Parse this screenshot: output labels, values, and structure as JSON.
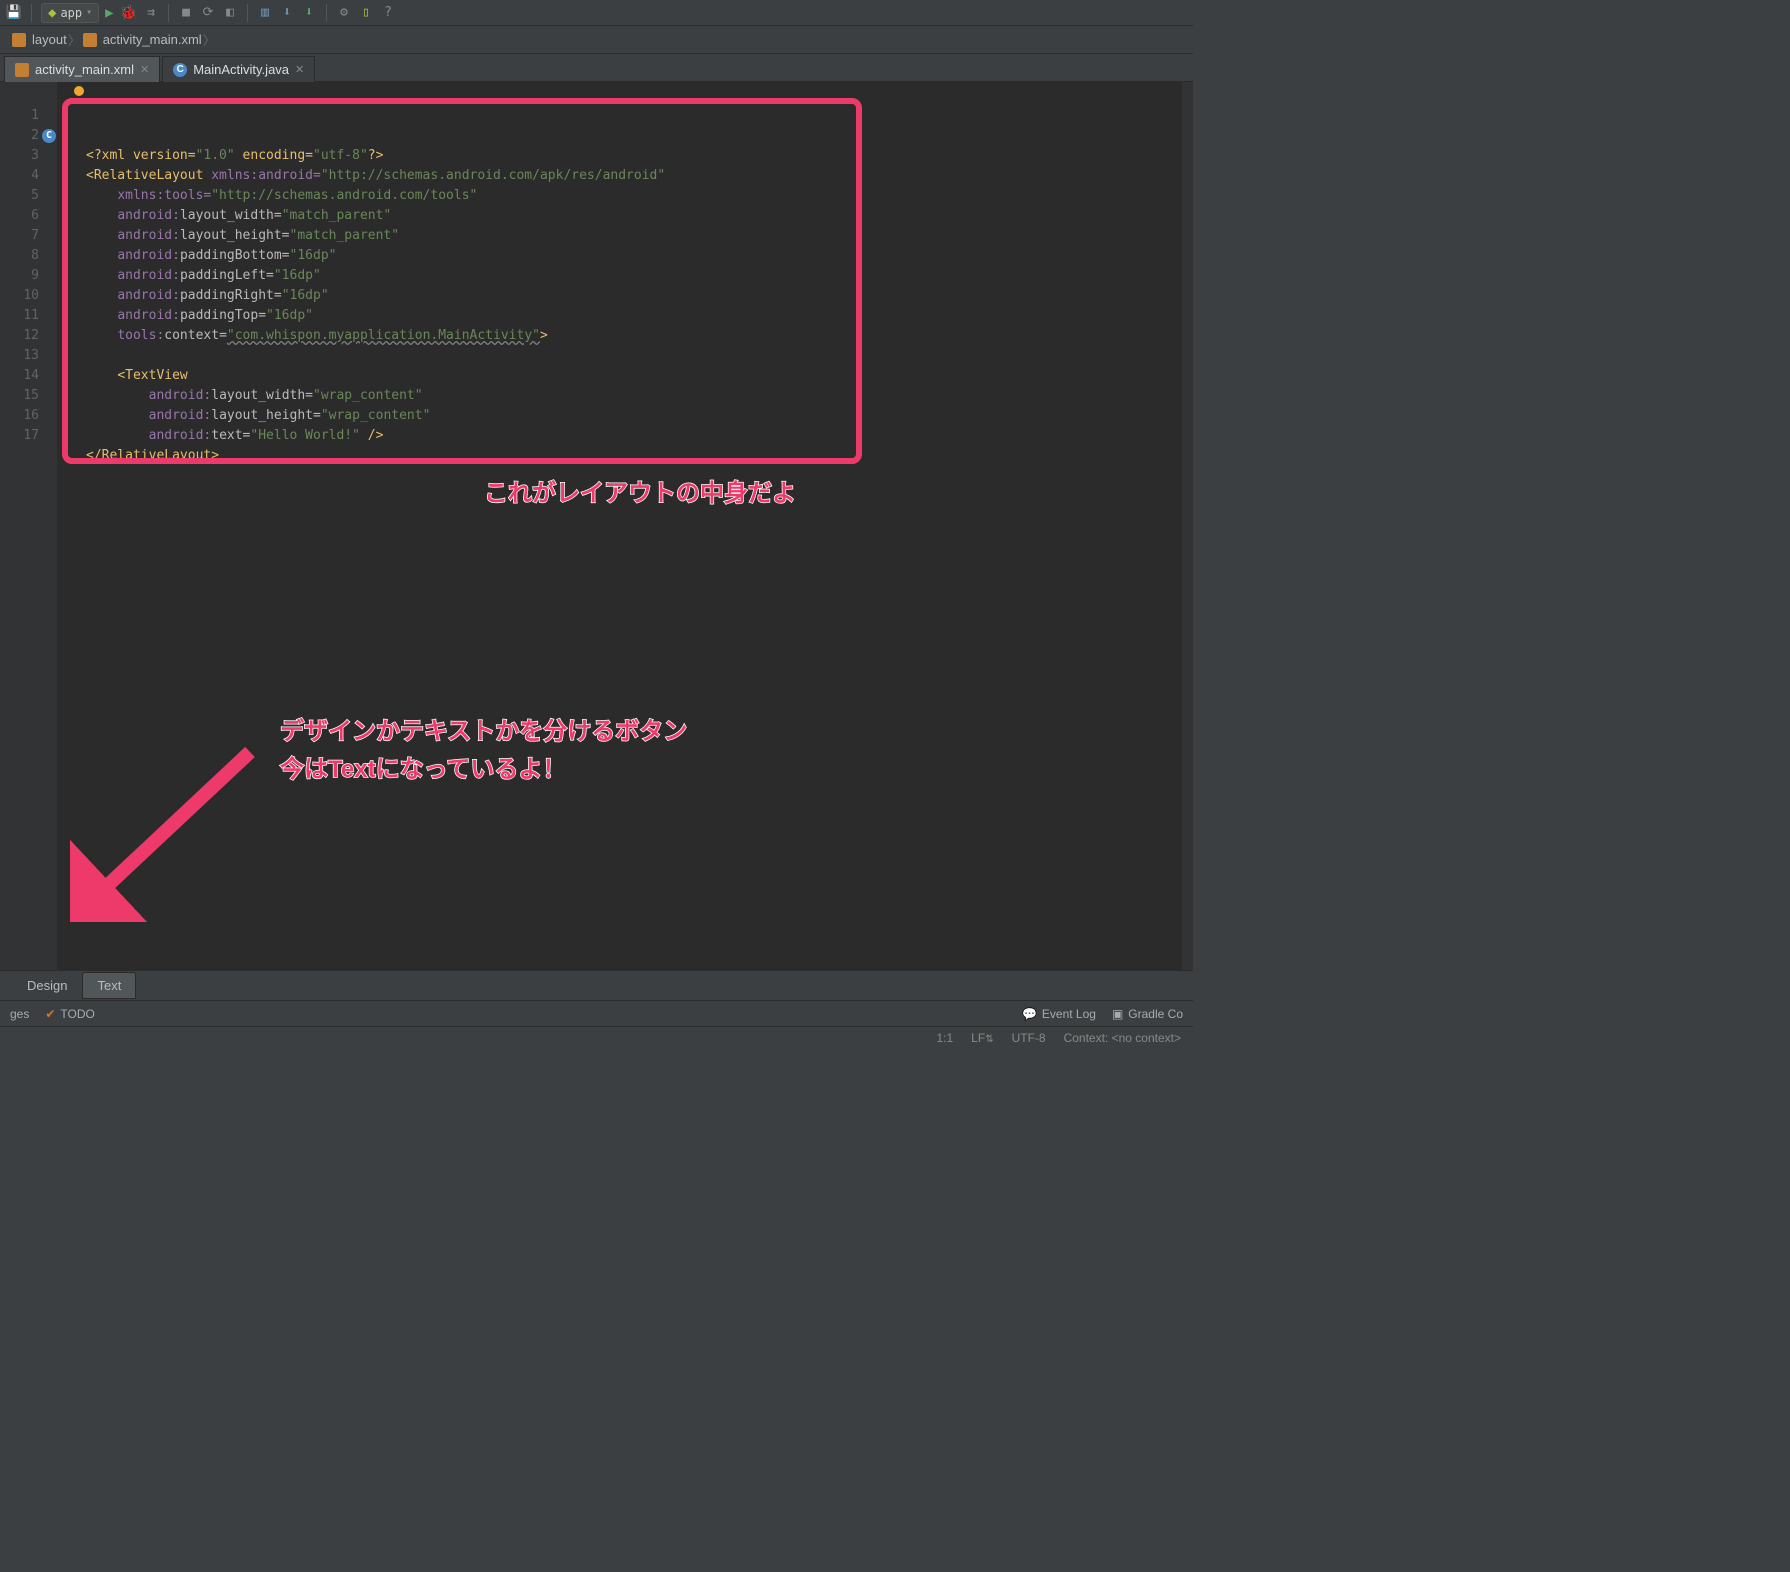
{
  "toolbar": {
    "module": "app"
  },
  "breadcrumb": {
    "items": [
      "layout",
      "activity_main.xml"
    ]
  },
  "editor_tabs": [
    {
      "label": "activity_main.xml",
      "type": "xml",
      "active": true
    },
    {
      "label": "MainActivity.java",
      "type": "java",
      "active": false
    }
  ],
  "gutter_lines": [
    "1",
    "2",
    "3",
    "4",
    "5",
    "6",
    "7",
    "8",
    "9",
    "10",
    "11",
    "12",
    "13",
    "14",
    "15",
    "16",
    "17"
  ],
  "code": {
    "l1_pi": "<?xml version=",
    "l1_v1": "\"1.0\"",
    "l1_enc": " encoding=",
    "l1_v2": "\"utf-8\"",
    "l1_piend": "?>",
    "l2_t": "<RelativeLayout ",
    "l2_a": "xmlns:android=",
    "l2_v": "\"http://schemas.android.com/apk/res/android\"",
    "l3_a": "xmlns:tools=",
    "l3_v": "\"http://schemas.android.com/tools\"",
    "l4_ns": "android:",
    "l4_a": "layout_width=",
    "l4_v": "\"match_parent\"",
    "l5_ns": "android:",
    "l5_a": "layout_height=",
    "l5_v": "\"match_parent\"",
    "l6_ns": "android:",
    "l6_a": "paddingBottom=",
    "l6_v": "\"16dp\"",
    "l7_ns": "android:",
    "l7_a": "paddingLeft=",
    "l7_v": "\"16dp\"",
    "l8_ns": "android:",
    "l8_a": "paddingRight=",
    "l8_v": "\"16dp\"",
    "l9_ns": "android:",
    "l9_a": "paddingTop=",
    "l9_v": "\"16dp\"",
    "l10_ns": "tools:",
    "l10_a": "context=",
    "l10_v": "\"com.whispon.myapplication.MainActivity\"",
    "l10_end": ">",
    "l12_t": "<TextView",
    "l13_ns": "android:",
    "l13_a": "layout_width=",
    "l13_v": "\"wrap_content\"",
    "l14_ns": "android:",
    "l14_a": "layout_height=",
    "l14_v": "\"wrap_content\"",
    "l15_ns": "android:",
    "l15_a": "text=",
    "l15_v": "\"Hello World!\"",
    "l15_end": " />",
    "l16_t": "</RelativeLayout>"
  },
  "annotations": {
    "label1": "これがレイアウトの中身だよ",
    "label2a": "デザインかテキストかを分けるボタン",
    "label2b": "今はTextになっているよ！"
  },
  "view_tabs": {
    "design": "Design",
    "text": "Text"
  },
  "toolwindow": {
    "left1": "ges",
    "todo": "TODO",
    "eventlog": "Event Log",
    "gradle": "Gradle Co"
  },
  "status": {
    "pos": "1:1",
    "le": "LF",
    "enc": "UTF-8",
    "ctx": "Context: <no context>"
  }
}
